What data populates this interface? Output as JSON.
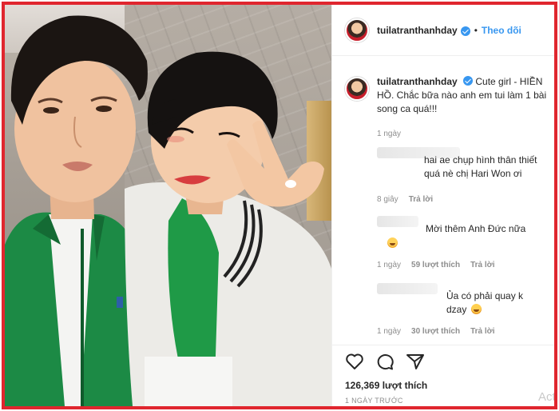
{
  "post": {
    "username": "tuilatranthanhday",
    "follow_label": "Theo dõi",
    "separator": "•",
    "caption_username": "tuilatranthanhday",
    "caption_text": "Cute girl - HIỀN HỒ. Chắc bữa nào anh em tui làm 1 bài song ca quá!!!",
    "caption_time": "1 ngày",
    "likes": "126,369 lượt thích",
    "date": "1 NGÀY TRƯỚC",
    "watermark": "Acti"
  },
  "comments": [
    {
      "text": "hai ae chụp hình thân thiết quá nè chị Hari Won ơi",
      "time": "8 giây",
      "likes": "",
      "reply": "Trả lời",
      "emoji": ""
    },
    {
      "text": "Mời thêm Anh Đức nữa",
      "time": "1 ngày",
      "likes": "59 lượt thích",
      "reply": "Trả lời",
      "emoji": "laughing-tears"
    },
    {
      "text": "Ủa có phải quay k dzay",
      "time": "1 ngày",
      "likes": "30 lượt thích",
      "reply": "Trả lời",
      "emoji": "sad-face"
    }
  ],
  "icons": {
    "verified": "verified-badge-icon",
    "like": "heart-icon",
    "comment": "comment-icon",
    "share": "share-icon"
  },
  "colors": {
    "frame": "#e0262e",
    "link": "#3897f0",
    "secondary_text": "#8e8e8e",
    "jacket_green": "#1c8a45"
  }
}
